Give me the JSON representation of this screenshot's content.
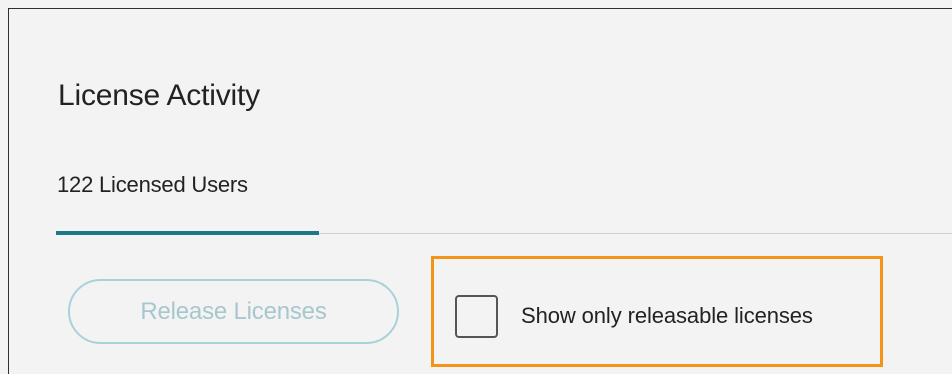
{
  "page": {
    "title": "License Activity"
  },
  "tabs": [
    {
      "label": "122 Licensed Users",
      "selected": true
    }
  ],
  "actions": {
    "release_label": "Release Licenses",
    "release_enabled": false
  },
  "filters": {
    "checkbox_label": "Show only releasable licenses",
    "checked": false
  },
  "colors": {
    "accent": "#1d7889",
    "highlight": "#f29417",
    "disabled_border": "#a9d1d8",
    "disabled_text": "#a7c7cf"
  }
}
